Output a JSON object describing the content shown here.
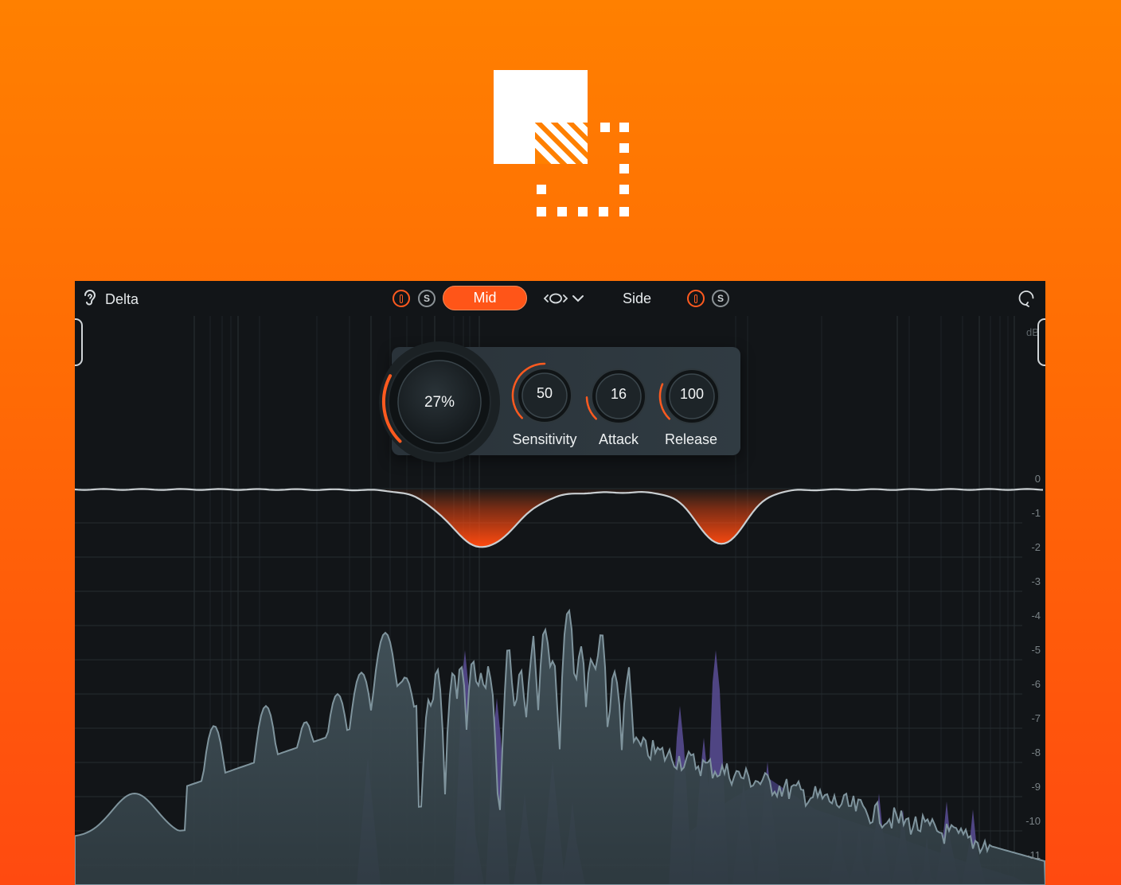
{
  "topbar": {
    "delta_label": "Delta",
    "mid_label": "Mid",
    "side_label": "Side",
    "solo_glyph": "S"
  },
  "icons": {
    "logo": "overlapping-squares-logo-icon",
    "listen": "ear-icon",
    "power": "power-icon",
    "link": "stereo-link-chevron-icon",
    "reset": "reset-icon"
  },
  "controls": {
    "amount": {
      "value": "27%",
      "level": 0.27
    },
    "sensitivity": {
      "label": "Sensitivity",
      "value": "50",
      "level": 0.5
    },
    "attack": {
      "label": "Attack",
      "value": "16",
      "level": 0.16
    },
    "release": {
      "label": "Release",
      "value": "100",
      "level": 0.25
    }
  },
  "graph": {
    "unit": "dB",
    "ticks": [
      "0",
      "-1",
      "-2",
      "-3",
      "-4",
      "-5",
      "-6",
      "-7",
      "-8",
      "-9",
      "-10",
      "-11"
    ]
  },
  "colors": {
    "accent": "#ff5518",
    "background_top": "#ff8000",
    "background_bottom": "#ff4a10",
    "panel": "#121518",
    "spectrum": "#3a4850",
    "spectrum_line": "#7f949d",
    "side_spectrum": "#5a4e96"
  }
}
